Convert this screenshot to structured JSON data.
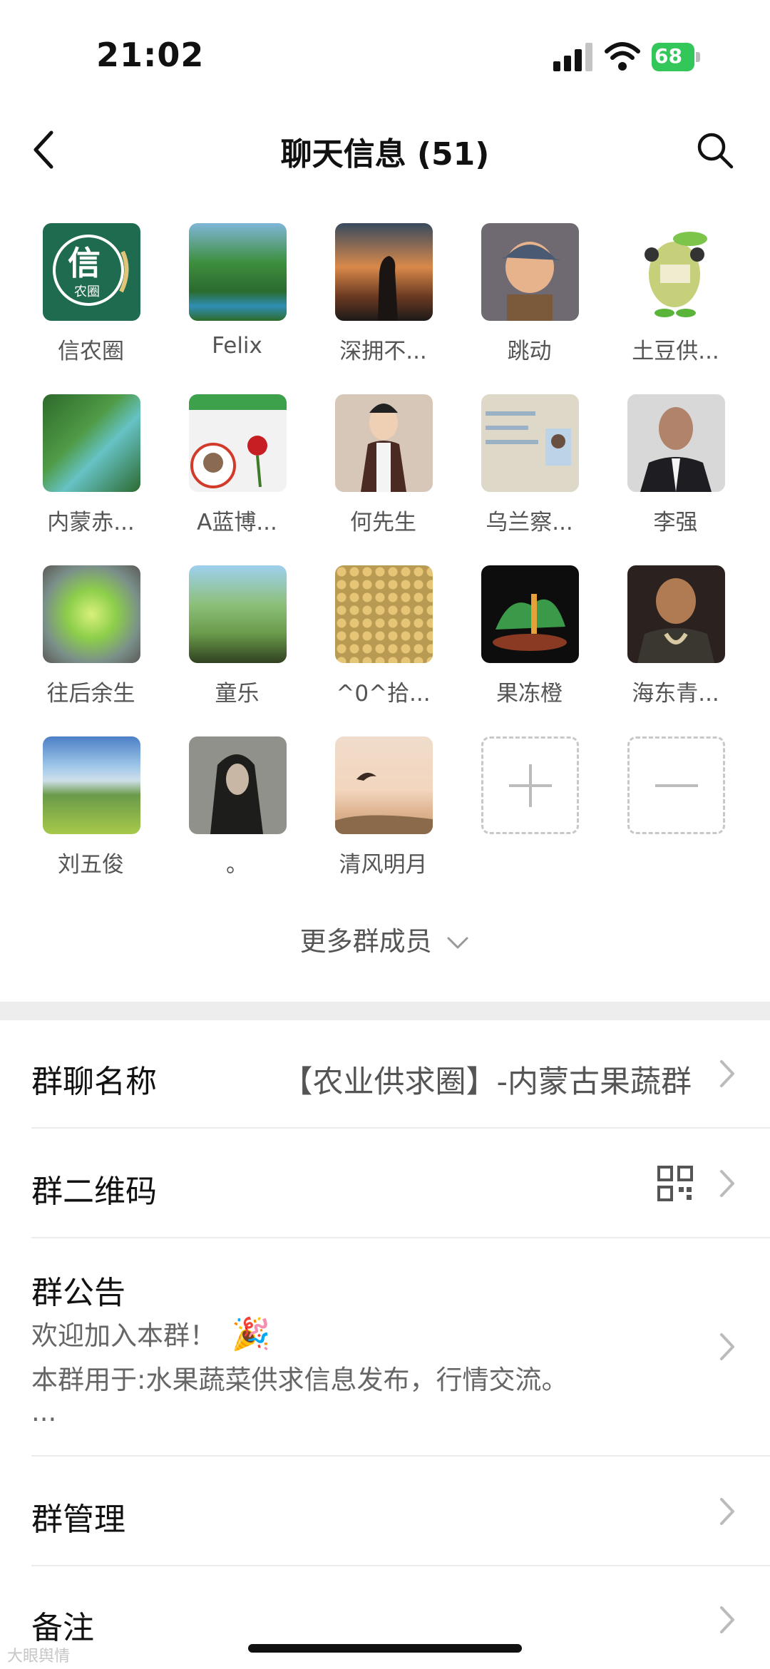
{
  "status_bar": {
    "time": "21:02",
    "battery": "68"
  },
  "nav": {
    "title": "聊天信息 (51)"
  },
  "members": [
    {
      "name": "信农圈"
    },
    {
      "name": "Felix"
    },
    {
      "name": "深拥不..."
    },
    {
      "name": "跳动"
    },
    {
      "name": "土豆供..."
    },
    {
      "name": "内蒙赤..."
    },
    {
      "name": "A蓝博..."
    },
    {
      "name": "何先生"
    },
    {
      "name": "乌兰察..."
    },
    {
      "name": "李强"
    },
    {
      "name": "往后余生"
    },
    {
      "name": "童乐"
    },
    {
      "name": "^0^拾..."
    },
    {
      "name": "果冻橙"
    },
    {
      "name": "海东青..."
    },
    {
      "name": "刘五俊"
    },
    {
      "name": "。"
    },
    {
      "name": "清风明月"
    }
  ],
  "avatar_logo": {
    "big": "信",
    "small": "农圈"
  },
  "more_members": "更多群成员",
  "settings": {
    "group_name": {
      "label": "群聊名称",
      "value": "【农业供求圈】-内蒙古果蔬群"
    },
    "qr_code": {
      "label": "群二维码"
    },
    "announcement": {
      "label": "群公告",
      "line1": "欢迎加入本群！",
      "line1_emoji": "🎉",
      "line2": "本群用于:水果蔬菜供求信息发布，行情交流。",
      "line3": "..."
    },
    "management": {
      "label": "群管理"
    },
    "remark": {
      "label": "备注"
    }
  },
  "watermark": "大眼舆情",
  "colors": {
    "battery": "#33c759",
    "logo_green": "#1f6b4f",
    "divider": "#ececec"
  }
}
